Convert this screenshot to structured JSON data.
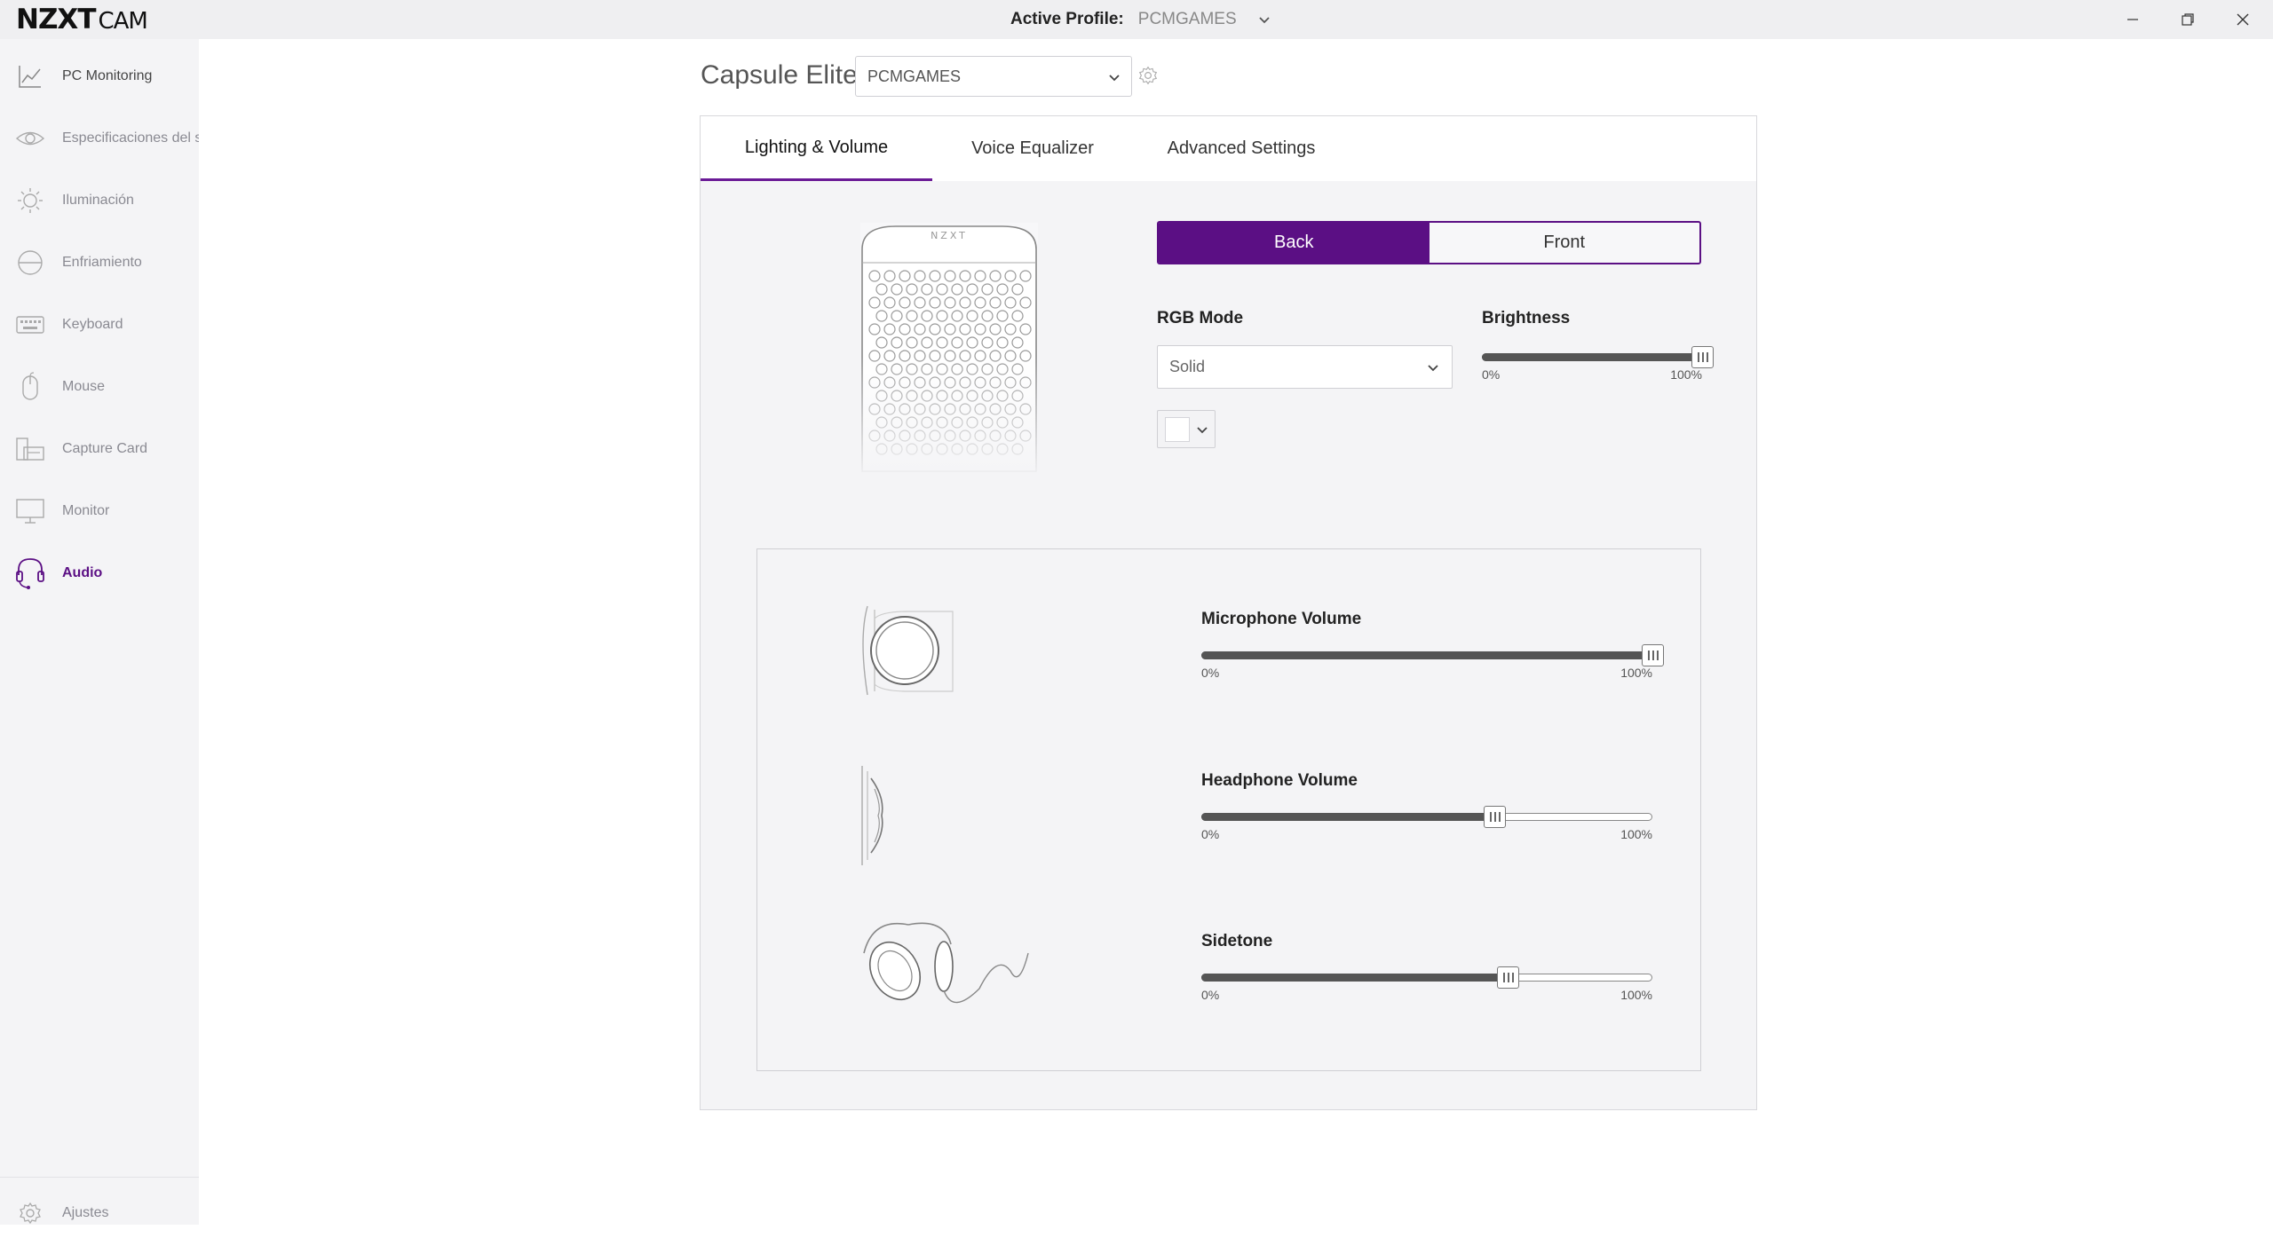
{
  "app": {
    "brand": "NZXT",
    "app_name": "CAM"
  },
  "titlebar": {
    "active_profile_label": "Active Profile:",
    "active_profile_value": "PCMGAMES"
  },
  "sidebar": {
    "items": [
      {
        "label": "PC Monitoring",
        "icon": "chart-line-icon"
      },
      {
        "label": "Especificaciones del sis",
        "icon": "eye-icon"
      },
      {
        "label": "Iluminación",
        "icon": "sun-icon"
      },
      {
        "label": "Enfriamiento",
        "icon": "cooler-icon"
      },
      {
        "label": "Keyboard",
        "icon": "keyboard-icon"
      },
      {
        "label": "Mouse",
        "icon": "mouse-icon"
      },
      {
        "label": "Capture Card",
        "icon": "capture-card-icon"
      },
      {
        "label": "Monitor",
        "icon": "monitor-icon"
      },
      {
        "label": "Audio",
        "icon": "headset-icon",
        "active": true
      }
    ],
    "settings_label": "Ajustes"
  },
  "header": {
    "device_name": "Capsule Elite",
    "profile_selected": "PCMGAMES"
  },
  "tabs": [
    {
      "label": "Lighting & Volume",
      "active": true
    },
    {
      "label": "Voice Equalizer"
    },
    {
      "label": "Advanced Settings"
    }
  ],
  "lighting": {
    "zone_back": "Back",
    "zone_front": "Front",
    "selected_zone": "Back",
    "rgb_mode_label": "RGB Mode",
    "rgb_mode_value": "Solid",
    "brightness_label": "Brightness",
    "brightness": {
      "value": 100,
      "min_label": "0%",
      "max_label": "100%"
    },
    "color": "#ffffff",
    "speaker_logo": "NZXT"
  },
  "volume": {
    "microphone": {
      "label": "Microphone Volume",
      "value": 100,
      "min_label": "0%",
      "max_label": "100%"
    },
    "headphone": {
      "label": "Headphone Volume",
      "value": 65,
      "min_label": "0%",
      "max_label": "100%"
    },
    "sidetone": {
      "label": "Sidetone",
      "value": 68,
      "min_label": "0%",
      "max_label": "100%"
    }
  },
  "colors": {
    "accent": "#5b0f84",
    "sidebar_bg": "#f4f4f6",
    "titlebar_bg": "#efeff1"
  }
}
